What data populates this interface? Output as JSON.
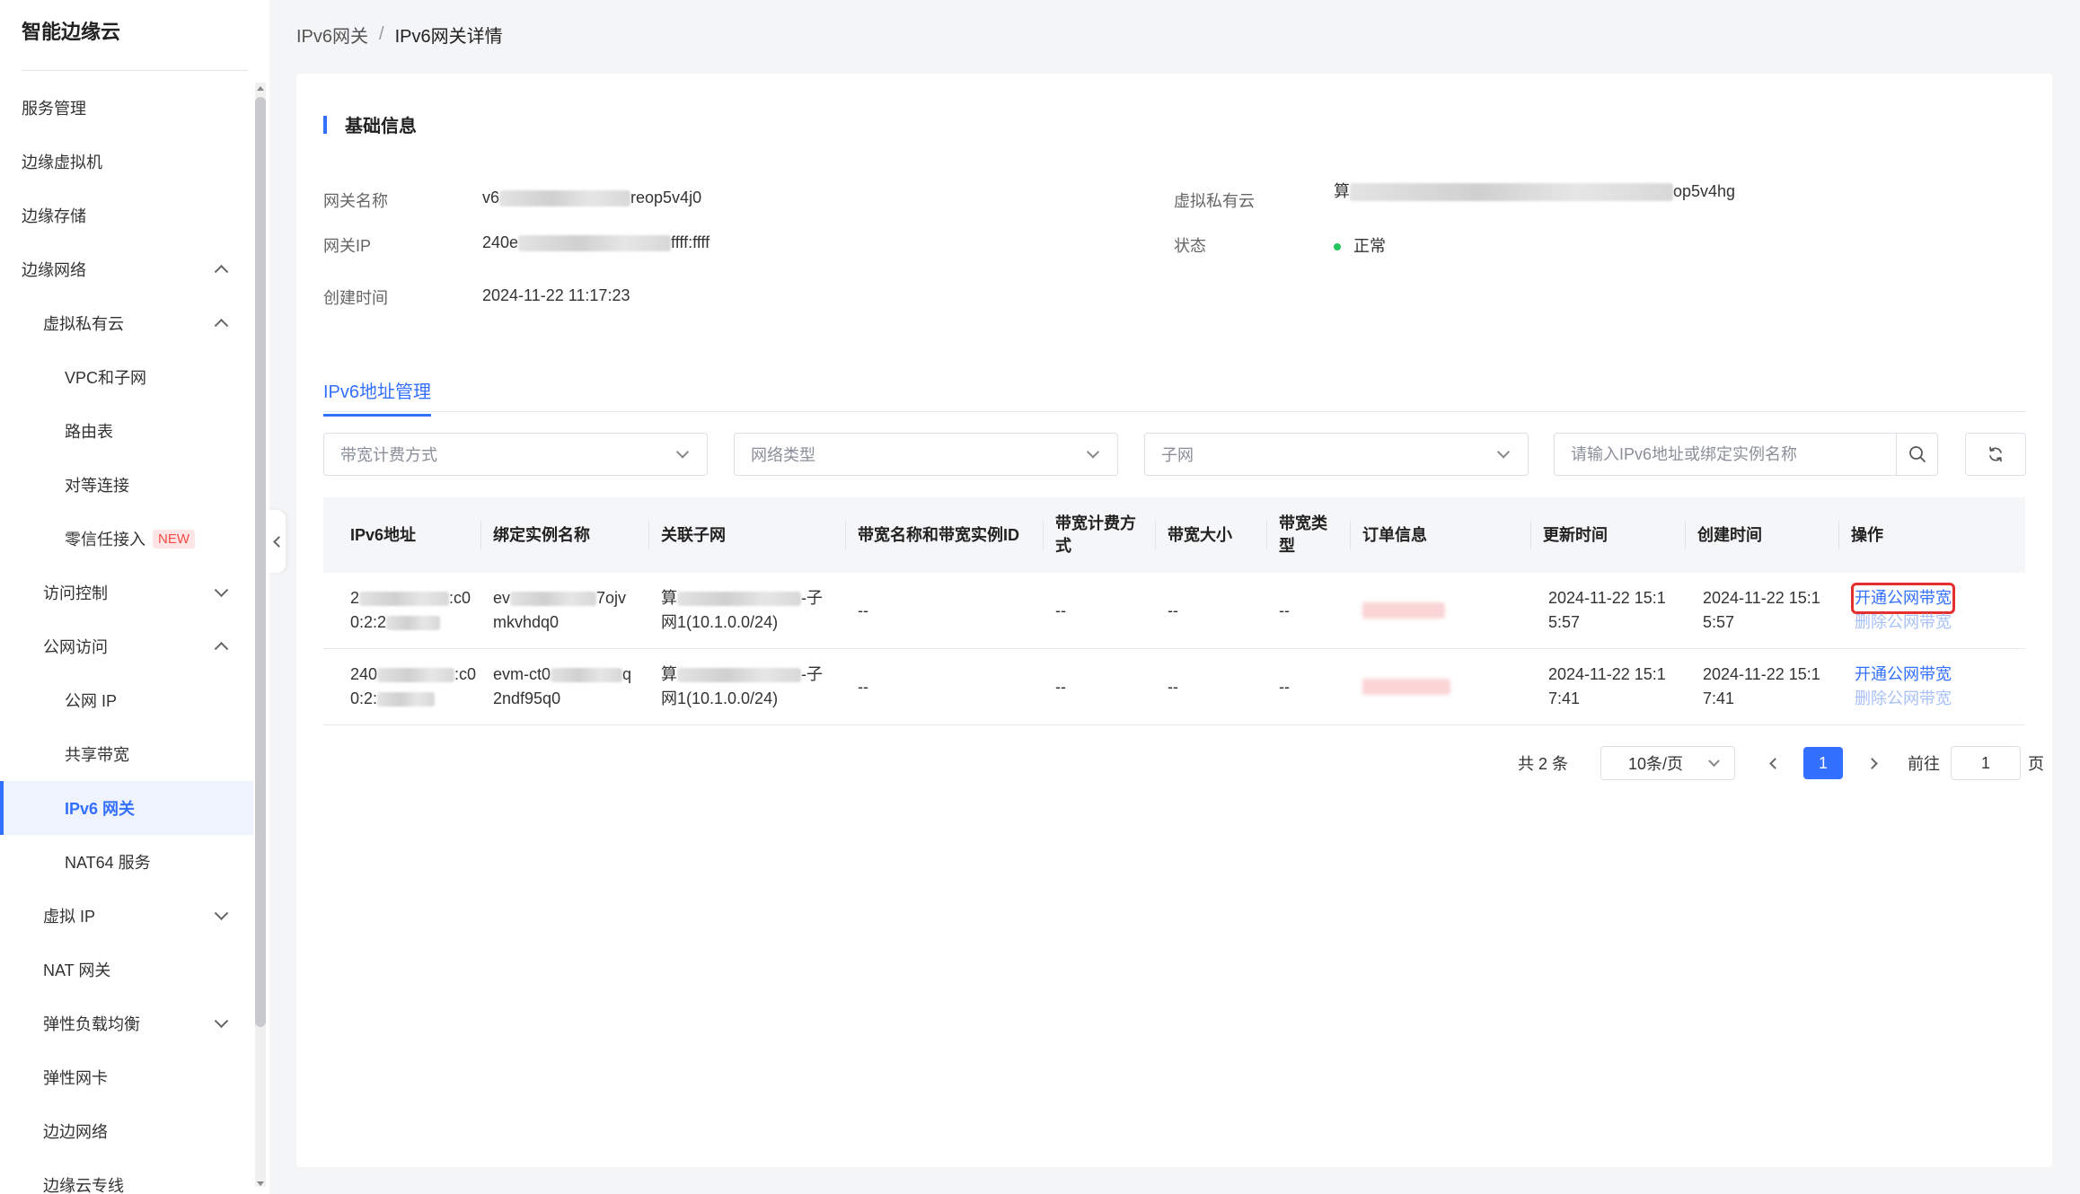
{
  "sidebar": {
    "brand": "智能边缘云",
    "items": [
      {
        "label": "服务管理",
        "level": 0
      },
      {
        "label": "边缘虚拟机",
        "level": 0
      },
      {
        "label": "边缘存储",
        "level": 0
      },
      {
        "label": "边缘网络",
        "level": 0,
        "expandable": true,
        "expanded": true
      },
      {
        "label": "虚拟私有云",
        "level": 1,
        "expandable": true,
        "expanded": true
      },
      {
        "label": "VPC和子网",
        "level": 2
      },
      {
        "label": "路由表",
        "level": 2
      },
      {
        "label": "对等连接",
        "level": 2
      },
      {
        "label": "零信任接入",
        "level": 2,
        "badge": "NEW"
      },
      {
        "label": "访问控制",
        "level": 1,
        "expandable": true,
        "expanded": false
      },
      {
        "label": "公网访问",
        "level": 1,
        "expandable": true,
        "expanded": true
      },
      {
        "label": "公网 IP",
        "level": 2
      },
      {
        "label": "共享带宽",
        "level": 2
      },
      {
        "label": "IPv6 网关",
        "level": 2,
        "active": true
      },
      {
        "label": "NAT64 服务",
        "level": 2
      },
      {
        "label": "虚拟 IP",
        "level": 1,
        "expandable": true,
        "expanded": false
      },
      {
        "label": "NAT 网关",
        "level": 1
      },
      {
        "label": "弹性负载均衡",
        "level": 1,
        "expandable": true,
        "expanded": false
      },
      {
        "label": "弹性网卡",
        "level": 1
      },
      {
        "label": "边边网络",
        "level": 1
      },
      {
        "label": "边缘云专线",
        "level": 1
      }
    ]
  },
  "breadcrumb": {
    "parent": "IPv6网关",
    "separator": "/",
    "current": "IPv6网关详情"
  },
  "basic_info": {
    "title": "基础信息",
    "gateway_name_label": "网关名称",
    "gateway_name_prefix": "v6",
    "gateway_name_suffix": "reop5v4j0",
    "gateway_ip_label": "网关IP",
    "gateway_ip_prefix": "240e",
    "gateway_ip_suffix": "ffff:ffff",
    "created_label": "创建时间",
    "created_value": "2024-11-22 11:17:23",
    "vpc_label": "虚拟私有云",
    "vpc_prefix": "算",
    "vpc_suffix": "op5v4hg",
    "status_label": "状态",
    "status_value": "正常",
    "status_color": "#22c55e"
  },
  "tabs": {
    "active": "IPv6地址管理"
  },
  "filters": {
    "billing_placeholder": "带宽计费方式",
    "network_type_placeholder": "网络类型",
    "subnet_placeholder": "子网",
    "search_placeholder": "请输入IPv6地址或绑定实例名称"
  },
  "table": {
    "headers": {
      "ipv6": "IPv6地址",
      "instance": "绑定实例名称",
      "subnet": "关联子网",
      "bandwidth_id": "带宽名称和带宽实例ID",
      "billing": "带宽计费方式",
      "size": "带宽大小",
      "type": "带宽类型",
      "order": "订单信息",
      "updated": "更新时间",
      "created": "创建时间",
      "ops": "操作"
    },
    "rows": [
      {
        "ipv6_a": "2",
        "ipv6_b": ":c0",
        "ipv6_c": "0:2:2",
        "instance_a": "ev",
        "instance_b": "7ojv",
        "instance_c": "mkvhdq0",
        "subnet_a": "算",
        "subnet_b": "-子",
        "subnet_c": "网1(10.1.0.0/24)",
        "bandwidth_id": "--",
        "billing": "--",
        "size": "--",
        "type": "--",
        "updated_a": "2024-11-22 15:1",
        "updated_b": "5:57",
        "created_a": "2024-11-22 15:1",
        "created_b": "5:57",
        "op_open": "开通公网带宽",
        "op_delete": "删除公网带宽"
      },
      {
        "ipv6_a": "240",
        "ipv6_b": ":c0",
        "ipv6_c": "0:2:",
        "instance_a": "evm-ct0",
        "instance_b": "q",
        "instance_c": "2ndf95q0",
        "subnet_a": "算",
        "subnet_b": "-子",
        "subnet_c": "网1(10.1.0.0/24)",
        "bandwidth_id": "--",
        "billing": "--",
        "size": "--",
        "type": "--",
        "updated_a": "2024-11-22 15:1",
        "updated_b": "7:41",
        "created_a": "2024-11-22 15:1",
        "created_b": "7:41",
        "op_open": "开通公网带宽",
        "op_delete": "删除公网带宽"
      }
    ]
  },
  "pagination": {
    "total": "共 2 条",
    "page_size": "10条/页",
    "current_page": "1",
    "goto_label": "前往",
    "goto_value": "1",
    "page_unit": "页"
  },
  "colors": {
    "accent": "#3370ff",
    "highlight_box": "#e52e2e",
    "badge_new": "#f54a45"
  }
}
